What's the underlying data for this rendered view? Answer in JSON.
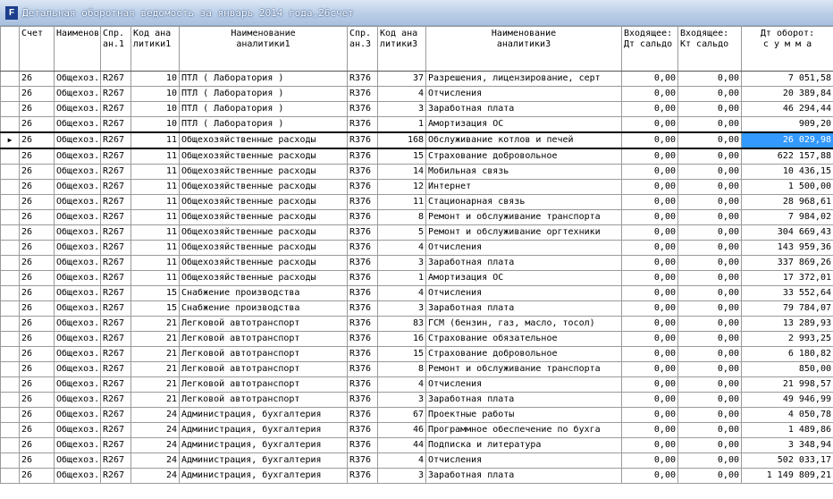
{
  "window": {
    "title": "Детальная оборотная ведомость за январь 2014 года,26счет",
    "icon": "fp-app-icon"
  },
  "columns": [
    [
      "Счет",
      ""
    ],
    [
      "Наименов",
      ""
    ],
    [
      "Спр.",
      "ан.1"
    ],
    [
      "Код ана",
      "литики1"
    ],
    [
      "Наименование",
      "аналитики1"
    ],
    [
      "Спр.",
      "ан.3"
    ],
    [
      "Код ана",
      "литики3"
    ],
    [
      "Наименование",
      "аналитики3"
    ],
    [
      "Входящее:",
      "Дт сальдо"
    ],
    [
      "Входящее:",
      "Кт сальдо"
    ],
    [
      "Дт оборот:",
      "с у м м а"
    ]
  ],
  "current_row_index": 4,
  "current_row_marker": "▶",
  "selected_cell_column": 10,
  "rows": [
    [
      "26",
      "Общехоз.",
      "R267",
      "10",
      "ПТЛ ( Лаборатория )",
      "R376",
      "37",
      "Разрешения, лицензирование, серт",
      "0,00",
      "0,00",
      "7 051,58"
    ],
    [
      "26",
      "Общехоз.",
      "R267",
      "10",
      "ПТЛ ( Лаборатория )",
      "R376",
      "4",
      "Отчисления",
      "0,00",
      "0,00",
      "20 389,84"
    ],
    [
      "26",
      "Общехоз.",
      "R267",
      "10",
      "ПТЛ ( Лаборатория )",
      "R376",
      "3",
      "Заработная плата",
      "0,00",
      "0,00",
      "46 294,44"
    ],
    [
      "26",
      "Общехоз.",
      "R267",
      "10",
      "ПТЛ ( Лаборатория )",
      "R376",
      "1",
      "Амортизация ОС",
      "0,00",
      "0,00",
      "909,20"
    ],
    [
      "26",
      "Общехоз.",
      "R267",
      "11",
      "Общехозяйственные расходы",
      "R376",
      "168",
      "Обслуживание котлов и печей",
      "0,00",
      "0,00",
      "26 029,98"
    ],
    [
      "26",
      "Общехоз.",
      "R267",
      "11",
      "Общехозяйственные расходы",
      "R376",
      "15",
      "Страхование добровольное",
      "0,00",
      "0,00",
      "622 157,88"
    ],
    [
      "26",
      "Общехоз.",
      "R267",
      "11",
      "Общехозяйственные расходы",
      "R376",
      "14",
      "Мобильная связь",
      "0,00",
      "0,00",
      "10 436,15"
    ],
    [
      "26",
      "Общехоз.",
      "R267",
      "11",
      "Общехозяйственные расходы",
      "R376",
      "12",
      "Интернет",
      "0,00",
      "0,00",
      "1 500,00"
    ],
    [
      "26",
      "Общехоз.",
      "R267",
      "11",
      "Общехозяйственные расходы",
      "R376",
      "11",
      "Стационарная связь",
      "0,00",
      "0,00",
      "28 968,61"
    ],
    [
      "26",
      "Общехоз.",
      "R267",
      "11",
      "Общехозяйственные расходы",
      "R376",
      "8",
      "Ремонт и обслуживание транспорта",
      "0,00",
      "0,00",
      "7 984,02"
    ],
    [
      "26",
      "Общехоз.",
      "R267",
      "11",
      "Общехозяйственные расходы",
      "R376",
      "5",
      "Ремонт и обслуживание оргтехники",
      "0,00",
      "0,00",
      "304 669,43"
    ],
    [
      "26",
      "Общехоз.",
      "R267",
      "11",
      "Общехозяйственные расходы",
      "R376",
      "4",
      "Отчисления",
      "0,00",
      "0,00",
      "143 959,36"
    ],
    [
      "26",
      "Общехоз.",
      "R267",
      "11",
      "Общехозяйственные расходы",
      "R376",
      "3",
      "Заработная плата",
      "0,00",
      "0,00",
      "337 869,26"
    ],
    [
      "26",
      "Общехоз.",
      "R267",
      "11",
      "Общехозяйственные расходы",
      "R376",
      "1",
      "Амортизация ОС",
      "0,00",
      "0,00",
      "17 372,01"
    ],
    [
      "26",
      "Общехоз.",
      "R267",
      "15",
      "Снабжение производства",
      "R376",
      "4",
      "Отчисления",
      "0,00",
      "0,00",
      "33 552,64"
    ],
    [
      "26",
      "Общехоз.",
      "R267",
      "15",
      "Снабжение производства",
      "R376",
      "3",
      "Заработная плата",
      "0,00",
      "0,00",
      "79 784,07"
    ],
    [
      "26",
      "Общехоз.",
      "R267",
      "21",
      "Легковой автотранспорт",
      "R376",
      "83",
      "ГСМ (бензин, газ, масло, тосол)",
      "0,00",
      "0,00",
      "13 289,93"
    ],
    [
      "26",
      "Общехоз.",
      "R267",
      "21",
      "Легковой автотранспорт",
      "R376",
      "16",
      "Страхование обязательное",
      "0,00",
      "0,00",
      "2 993,25"
    ],
    [
      "26",
      "Общехоз.",
      "R267",
      "21",
      "Легковой автотранспорт",
      "R376",
      "15",
      "Страхование добровольное",
      "0,00",
      "0,00",
      "6 180,82"
    ],
    [
      "26",
      "Общехоз.",
      "R267",
      "21",
      "Легковой автотранспорт",
      "R376",
      "8",
      "Ремонт и обслуживание транспорта",
      "0,00",
      "0,00",
      "850,00"
    ],
    [
      "26",
      "Общехоз.",
      "R267",
      "21",
      "Легковой автотранспорт",
      "R376",
      "4",
      "Отчисления",
      "0,00",
      "0,00",
      "21 998,57"
    ],
    [
      "26",
      "Общехоз.",
      "R267",
      "21",
      "Легковой автотранспорт",
      "R376",
      "3",
      "Заработная плата",
      "0,00",
      "0,00",
      "49 946,99"
    ],
    [
      "26",
      "Общехоз.",
      "R267",
      "24",
      "Администрация, бухгалтерия",
      "R376",
      "67",
      "Проектные работы",
      "0,00",
      "0,00",
      "4 050,78"
    ],
    [
      "26",
      "Общехоз.",
      "R267",
      "24",
      "Администрация, бухгалтерия",
      "R376",
      "46",
      "Программное обеспечение по бухга",
      "0,00",
      "0,00",
      "1 489,86"
    ],
    [
      "26",
      "Общехоз.",
      "R267",
      "24",
      "Администрация, бухгалтерия",
      "R376",
      "44",
      "Подписка и литература",
      "0,00",
      "0,00",
      "3 348,94"
    ],
    [
      "26",
      "Общехоз.",
      "R267",
      "24",
      "Администрация, бухгалтерия",
      "R376",
      "4",
      "Отчисления",
      "0,00",
      "0,00",
      "502 033,17"
    ],
    [
      "26",
      "Общехоз.",
      "R267",
      "24",
      "Администрация, бухгалтерия",
      "R376",
      "3",
      "Заработная плата",
      "0,00",
      "0,00",
      "1 149 809,21"
    ]
  ]
}
